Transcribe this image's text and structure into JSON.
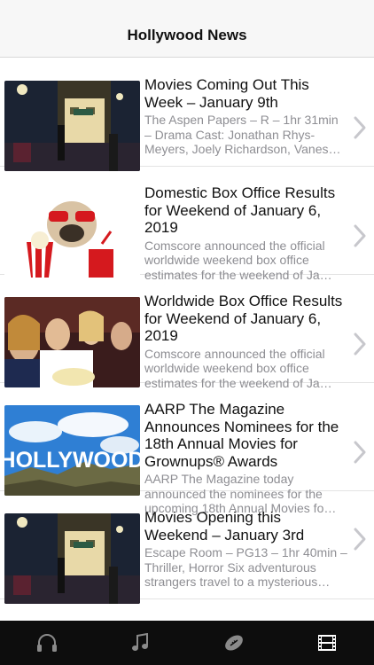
{
  "header": {
    "title": "Hollywood News"
  },
  "articles": [
    {
      "title": "Movies Coming Out This Week – January 9th",
      "summary": "The Aspen Papers – R – 1hr 31min – Drama Cast: Jonathan Rhys-Meyers, Joely Richardson, Vanes…",
      "thumbnail": "street-night-film-set"
    },
    {
      "title": "Domestic Box Office Results for Weekend of January 6, 2019",
      "summary": "Comscore announced the official worldwide weekend box office estimates for the weekend of Ja…",
      "thumbnail": "pug-with-popcorn-and-soda"
    },
    {
      "title": "Worldwide Box Office Results for Weekend of January 6, 2019",
      "summary": "Comscore announced the official worldwide weekend box office estimates for the weekend of Ja…",
      "thumbnail": "audience-eating-popcorn"
    },
    {
      "title": "AARP The Magazine Announces Nominees for the 18th Annual Movies for Grownups® Awards",
      "summary": "AARP The Magazine today announced the nominees for the upcoming 18th Annual Movies fo…",
      "thumbnail": "hollywood-sign"
    },
    {
      "title": "Movies Opening this Weekend – January 3rd",
      "summary": "Escape Room – PG13 – 1hr 40min – Thriller, Horror Six adventurous strangers travel to a mysterious…",
      "thumbnail": "street-night-film-set"
    }
  ],
  "hollywood_sign_text": "HOLLYWOOD",
  "tabbar": {
    "tabs": [
      "headphones-icon",
      "music-note-icon",
      "football-icon",
      "film-icon"
    ],
    "active_index": 3
  },
  "colors": {
    "chevron": "#c7c7cc",
    "secondary_text": "#8e8e93",
    "tab_active": "#ffffff",
    "tab_inactive": "#8a8a8a"
  }
}
